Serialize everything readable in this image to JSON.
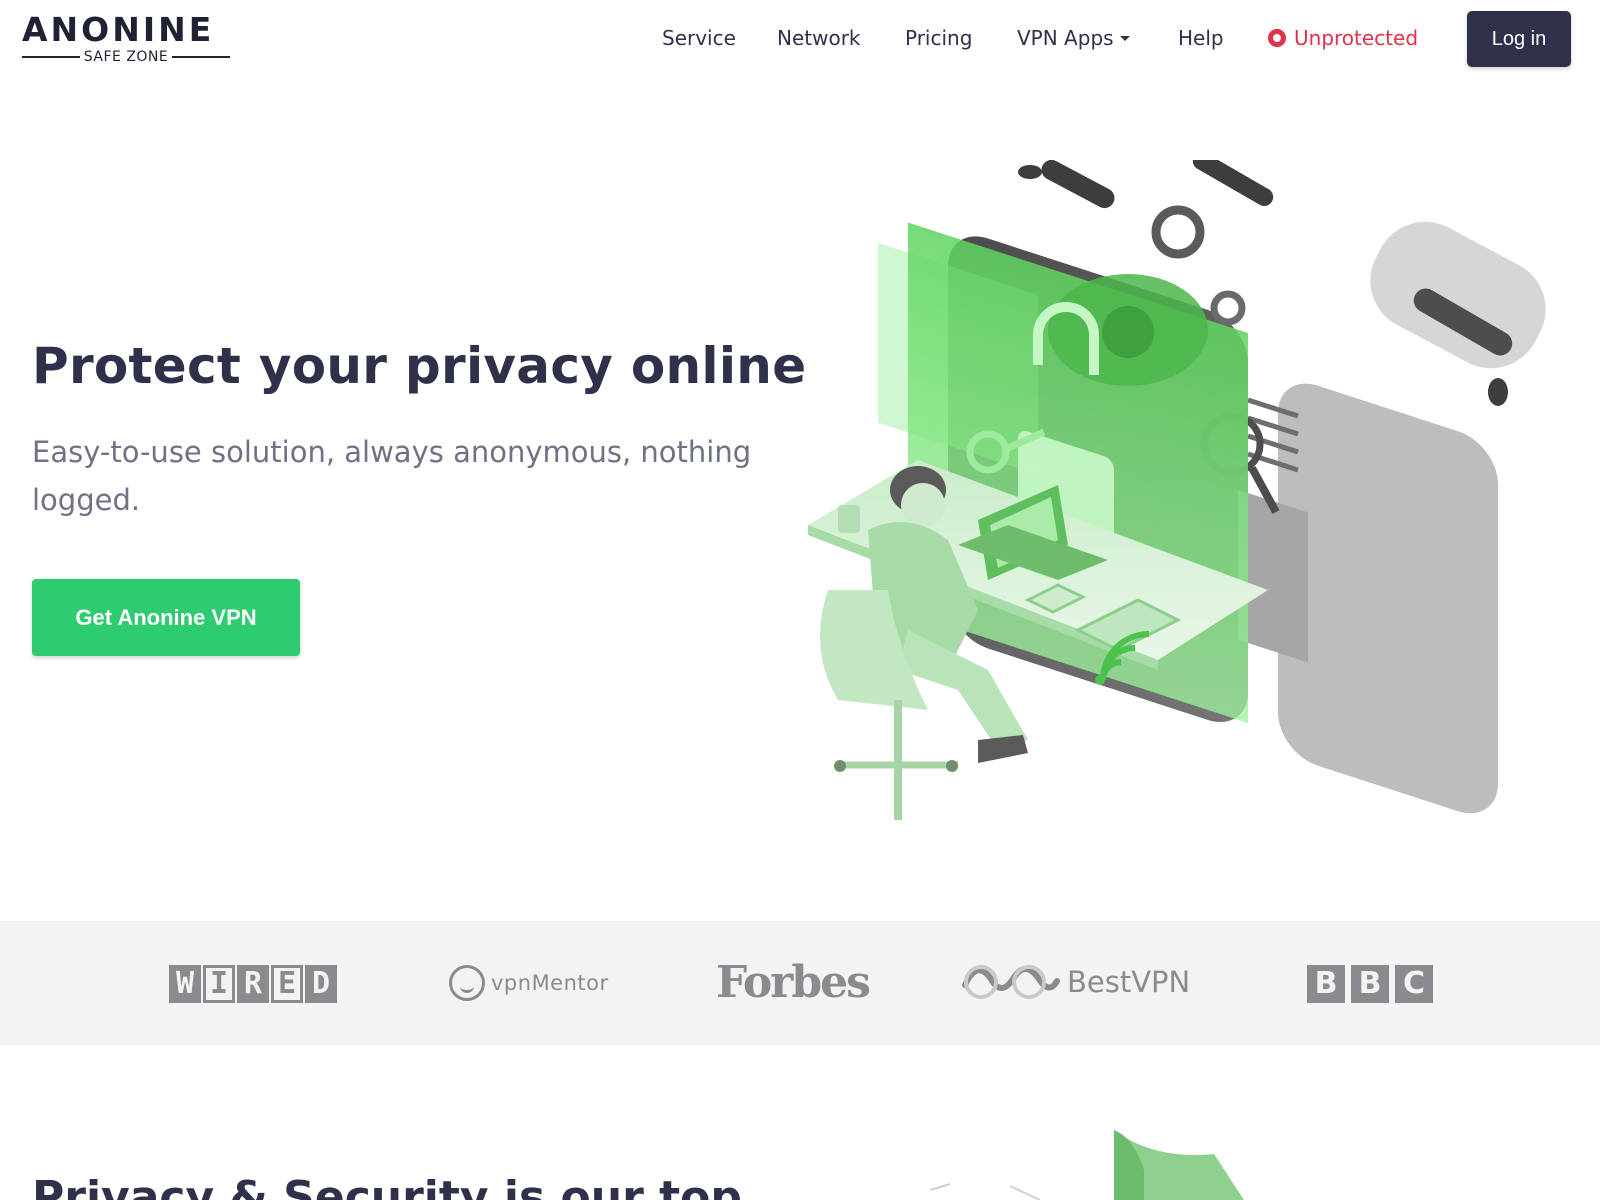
{
  "brand": {
    "name": "ANONINE",
    "tagline": "SAFE ZONE"
  },
  "nav": {
    "items": [
      {
        "label": "Service"
      },
      {
        "label": "Network"
      },
      {
        "label": "Pricing"
      },
      {
        "label": "VPN Apps"
      },
      {
        "label": "Help"
      }
    ],
    "status": {
      "label": "Unprotected",
      "color": "#e0324a"
    },
    "login_label": "Log in"
  },
  "hero": {
    "title": "Protect your privacy online",
    "subtitle": "Easy-to-use solution, always anonymous, nothing logged.",
    "cta_label": "Get Anonine VPN",
    "cta_color": "#2ecc71"
  },
  "press": {
    "logos": [
      {
        "name": "WIRED",
        "icon": "wired-logo"
      },
      {
        "name": "vpnMentor",
        "icon": "vpnmentor-logo"
      },
      {
        "name": "Forbes",
        "icon": "forbes-logo"
      },
      {
        "name": "BestVPN",
        "icon": "bestvpn-logo"
      },
      {
        "name": "BBC",
        "icon": "bbc-logo"
      }
    ]
  },
  "section2": {
    "title_partial": "Privacy & Security is our top"
  },
  "colors": {
    "primary_dark": "#2e3149",
    "accent_green": "#2ecc71",
    "danger_red": "#e0324a",
    "band_gray": "#f3f3f4"
  }
}
